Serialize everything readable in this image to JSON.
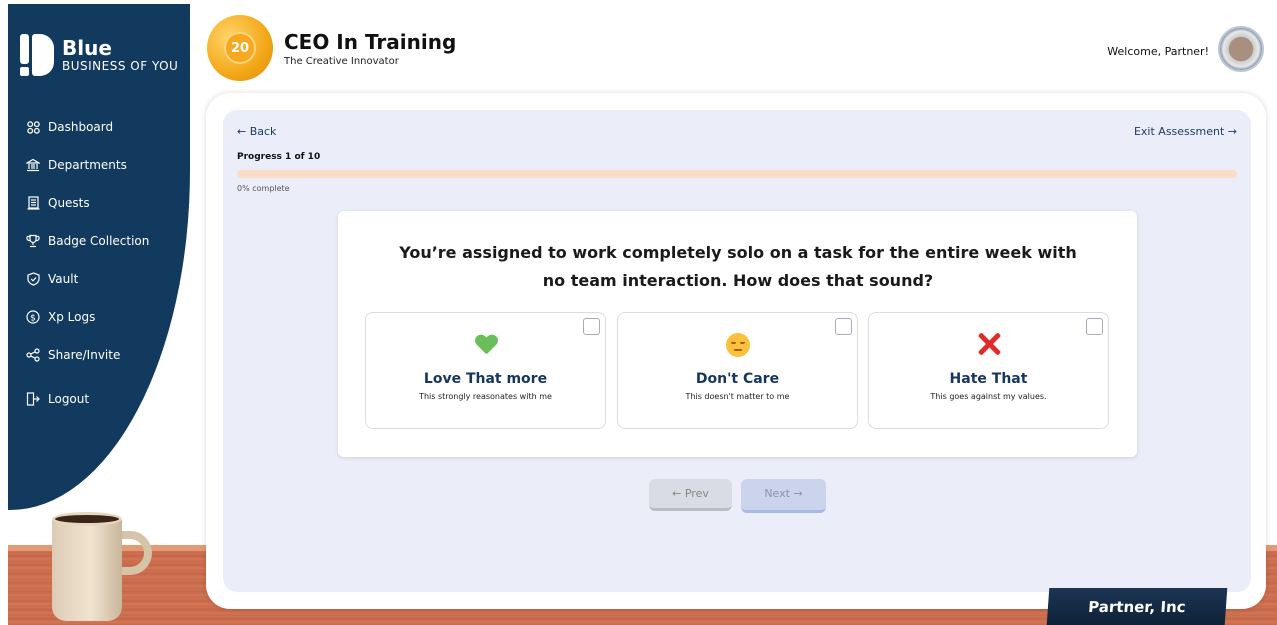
{
  "brand": {
    "name": "Blue",
    "tagline": "BUSINESS OF YOU"
  },
  "sidebar": {
    "items": [
      {
        "label": "Dashboard",
        "icon": "grid-icon"
      },
      {
        "label": "Departments",
        "icon": "bank-icon"
      },
      {
        "label": "Quests",
        "icon": "scroll-icon"
      },
      {
        "label": "Badge Collection",
        "icon": "trophy-icon"
      },
      {
        "label": "Vault",
        "icon": "shield-icon"
      },
      {
        "label": "Xp Logs",
        "icon": "dollar-circle-icon"
      },
      {
        "label": "Share/Invite",
        "icon": "share-icon"
      },
      {
        "label": "Logout",
        "icon": "logout-icon"
      }
    ]
  },
  "header": {
    "level": "20",
    "rank_title": "CEO In Training",
    "rank_subtitle": "The Creative Innovator",
    "welcome": "Welcome, Partner!"
  },
  "assessment": {
    "back_label": "← Back",
    "exit_label": "Exit Assessment →",
    "progress_label": "Progress 1 of 10",
    "progress_percent_label": "0% complete",
    "progress_value": 0,
    "question": "You’re assigned to work completely solo on a task for the entire week with no team interaction. How does that sound?",
    "options": [
      {
        "title": "Love That more",
        "description": "This strongly reasonates with me",
        "icon": "green-heart-icon"
      },
      {
        "title": "Don't Care",
        "description": "This doesn't matter to me",
        "icon": "pensive-face-icon"
      },
      {
        "title": "Hate That",
        "description": "This goes against my values.",
        "icon": "red-cross-icon"
      }
    ],
    "prev_label": "← Prev",
    "next_label": "Next →"
  },
  "nameplate": "Partner, Inc",
  "colors": {
    "sidebar_bg": "#113a5e",
    "accent_orange": "#f28a4b",
    "progress_track": "#fbdcc9",
    "panel_bg": "#ebeef9",
    "option_title": "#16365e"
  }
}
